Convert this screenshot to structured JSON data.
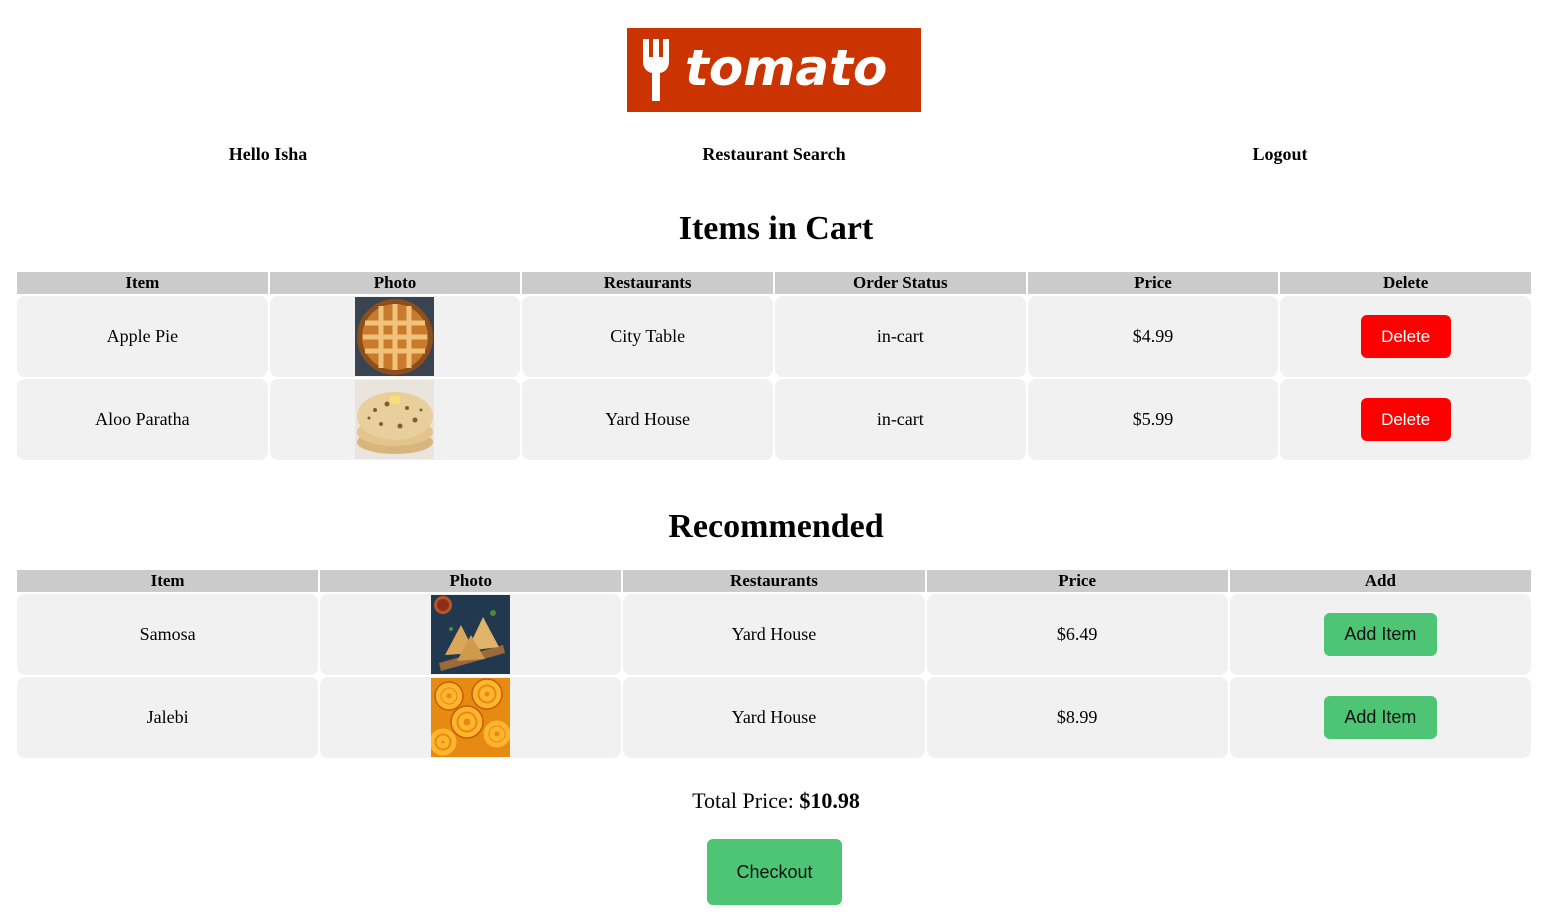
{
  "logo": {
    "text": "tomato",
    "icon": "fork-icon",
    "bg_color": "#cb3400"
  },
  "nav": {
    "greeting": "Hello Isha",
    "search": "Restaurant Search",
    "logout": "Logout"
  },
  "cart": {
    "title": "Items in Cart",
    "headers": [
      "Item",
      "Photo",
      "Restaurants",
      "Order Status",
      "Price",
      "Delete"
    ],
    "rows": [
      {
        "item": "Apple Pie",
        "photo": "apple-pie-photo",
        "restaurant": "City Table",
        "status": "in-cart",
        "price": "$4.99",
        "action": "Delete"
      },
      {
        "item": "Aloo Paratha",
        "photo": "aloo-paratha-photo",
        "restaurant": "Yard House",
        "status": "in-cart",
        "price": "$5.99",
        "action": "Delete"
      }
    ]
  },
  "recommended": {
    "title": "Recommended",
    "headers": [
      "Item",
      "Photo",
      "Restaurants",
      "Price",
      "Add"
    ],
    "rows": [
      {
        "item": "Samosa",
        "photo": "samosa-photo",
        "restaurant": "Yard House",
        "price": "$6.49",
        "action": "Add Item"
      },
      {
        "item": "Jalebi",
        "photo": "jalebi-photo",
        "restaurant": "Yard House",
        "price": "$8.99",
        "action": "Add Item"
      }
    ]
  },
  "total": {
    "label": "Total Price: ",
    "value": "$10.98"
  },
  "checkout": {
    "label": "Checkout"
  },
  "colors": {
    "delete": "#ff0000",
    "add": "#4dc574",
    "header_bg": "#cbcbcb",
    "cell_bg": "#f1f1f1"
  }
}
